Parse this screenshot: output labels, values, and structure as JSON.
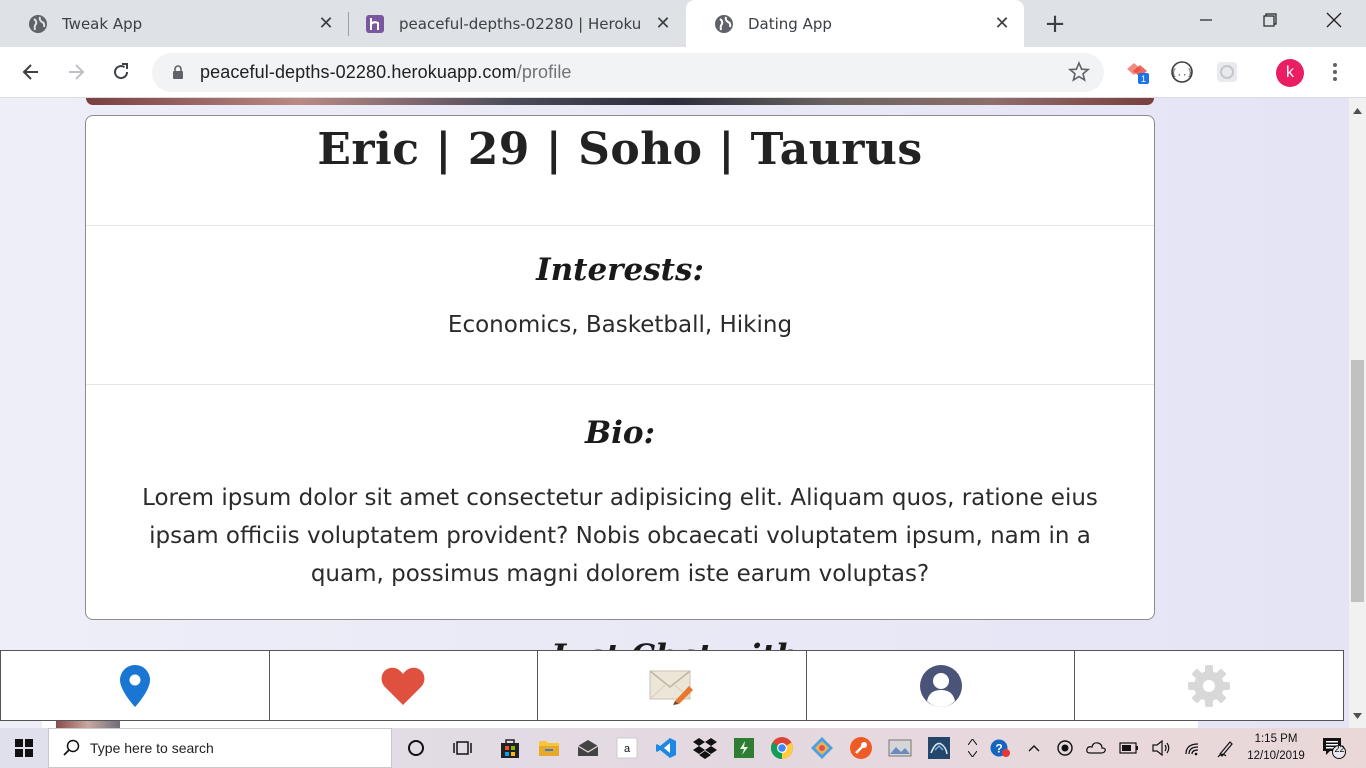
{
  "browser": {
    "tabs": [
      {
        "title": "Tweak App",
        "active": false
      },
      {
        "title": "peaceful-depths-02280 | Heroku",
        "active": false
      },
      {
        "title": "Dating App",
        "active": true
      }
    ],
    "url_host": "peaceful-depths-02280.herokuapp.com",
    "url_path": "/profile",
    "profile_initial": "k",
    "extension_badge": "1"
  },
  "profile": {
    "heading": "Eric | 29 | Soho | Taurus",
    "interests_title": "Interests:",
    "interests": "Economics, Basketball, Hiking",
    "bio_title": "Bio:",
    "bio": "Lorem ipsum dolor sit amet consectetur adipisicing elit. Aliquam quos, ratione eius ipsam officiis voluptatem provident? Nobis obcaecati voluptatem ipsum, nam in a quam, possimus magni dolorem iste earum voluptas?",
    "next_heading_partial": "Just Chat with"
  },
  "bottom_nav": [
    {
      "icon": "location-pin-icon"
    },
    {
      "icon": "heart-icon"
    },
    {
      "icon": "mail-icon"
    },
    {
      "icon": "user-icon"
    },
    {
      "icon": "gear-icon"
    }
  ],
  "taskbar": {
    "search_placeholder": "Type here to search",
    "time": "1:15 PM",
    "date": "12/10/2019",
    "notifications": "22"
  },
  "colors": {
    "pin": "#1976d2",
    "heart": "#e0503f",
    "user": "#4a5478",
    "gear": "#d8d8d8",
    "profile_avatar": "#e91e63"
  }
}
